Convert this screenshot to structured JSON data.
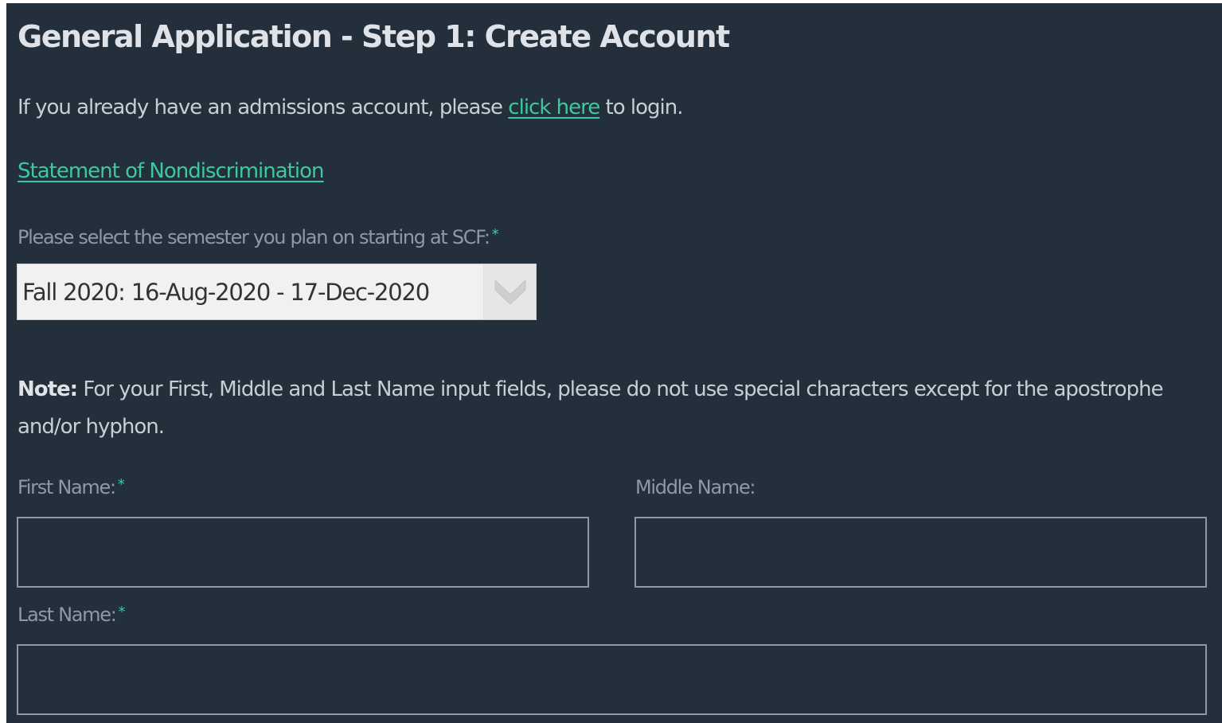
{
  "page": {
    "title": "General Application - Step 1: Create Account"
  },
  "intro": {
    "text_before": "If you already have an admissions account, please ",
    "link_label": "click here",
    "text_after": " to login."
  },
  "nondiscrimination_link": "Statement of Nondiscrimination",
  "semester": {
    "label": "Please select the semester you plan on starting at SCF:",
    "required_mark": "*",
    "selected_value": "Fall 2020: 16-Aug-2020 - 17-Dec-2020",
    "arrow_icon": "chevron-down-icon"
  },
  "note": {
    "label": "Note:",
    "text": " For your First, Middle and Last Name input fields, please do not use special characters except for the apostrophe and/or hyphon."
  },
  "fields": {
    "first_name": {
      "label": "First Name:",
      "required_mark": "*",
      "value": ""
    },
    "middle_name": {
      "label": "Middle Name:",
      "value": ""
    },
    "last_name": {
      "label": "Last Name:",
      "required_mark": "*",
      "value": ""
    }
  },
  "colors": {
    "background": "#232f3a",
    "link": "#3dc7a3",
    "label": "#8f99a3",
    "text": "#c8ced4"
  }
}
